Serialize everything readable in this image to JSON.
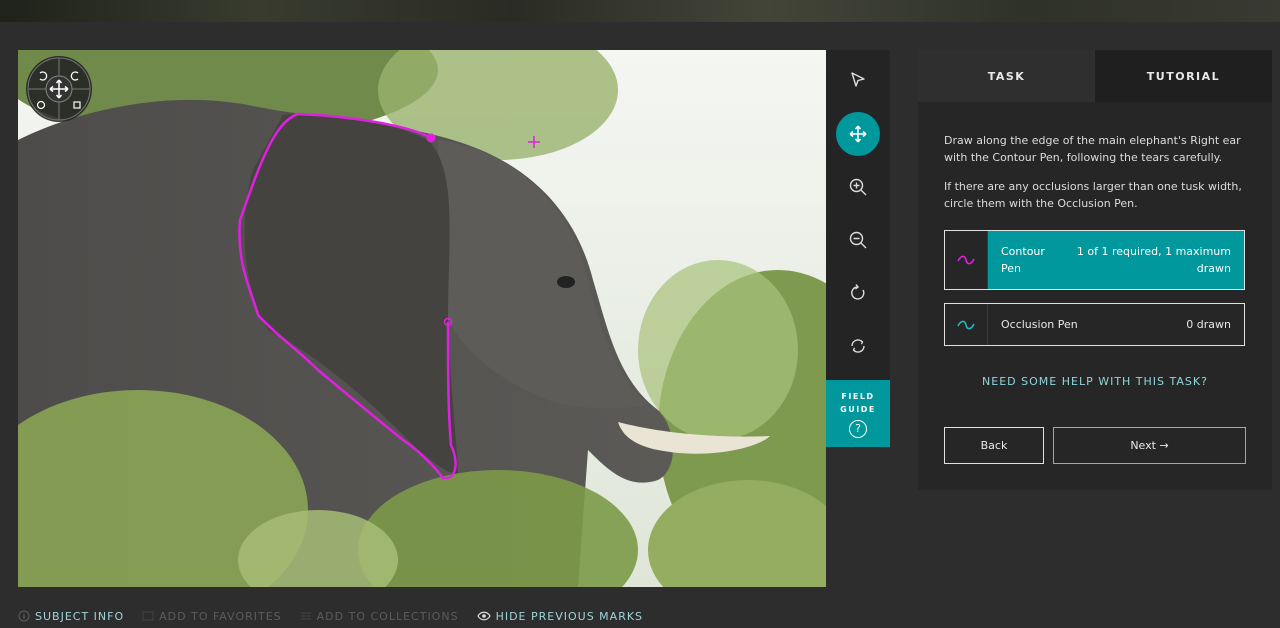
{
  "panel": {
    "tabs": [
      {
        "label": "TASK",
        "active": true
      },
      {
        "label": "TUTORIAL",
        "active": false
      }
    ],
    "instructions": [
      "Draw along the edge of the main elephant's Right ear with the Contour Pen, following the tears carefully.",
      "If there are any occlusions larger than one tusk width, circle them with the Occlusion Pen."
    ],
    "tools": [
      {
        "icon": "wave-icon",
        "label": "Contour Pen",
        "count": "1 of 1 required, 1 maximum drawn",
        "color": "#e020e0",
        "selected": true
      },
      {
        "icon": "wave-icon",
        "label": "Occlusion Pen",
        "count": "0 drawn",
        "color": "#1fbcc4",
        "selected": false
      }
    ],
    "help_link": "NEED SOME HELP WITH THIS TASK?",
    "back_label": "Back",
    "next_label": "Next →"
  },
  "toolbar": {
    "items": [
      {
        "icon": "pointer-icon"
      },
      {
        "icon": "move-icon",
        "active": true
      },
      {
        "icon": "zoom-in-icon"
      },
      {
        "icon": "zoom-out-icon"
      },
      {
        "icon": "rotate-icon"
      },
      {
        "icon": "reset-icon"
      }
    ],
    "field_guide": "FIELD GUIDE"
  },
  "footer": {
    "subject_info": "SUBJECT INFO",
    "add_favorites": "ADD TO FAVORITES",
    "add_collections": "ADD TO COLLECTIONS",
    "hide_marks": "HIDE PREVIOUS MARKS"
  },
  "colors": {
    "accent": "#00979d",
    "contour_mark": "#e020e0",
    "next_border": "#d4a628"
  }
}
